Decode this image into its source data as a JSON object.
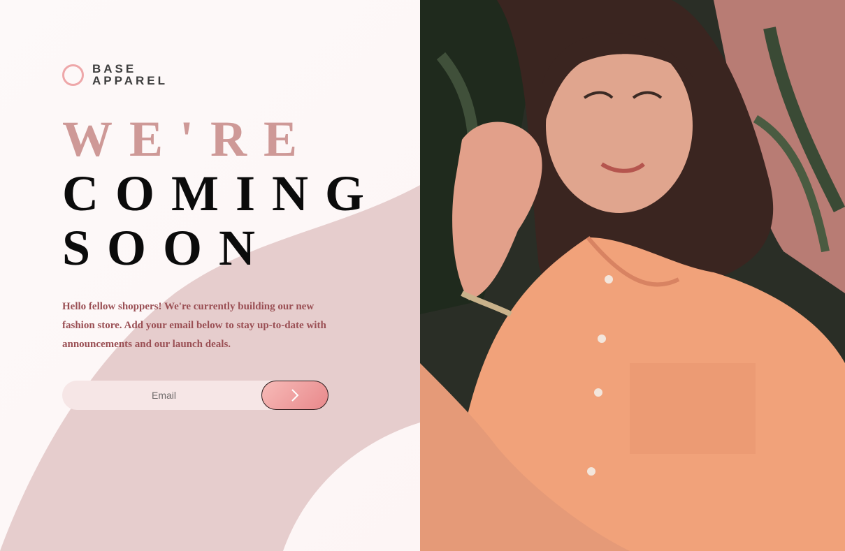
{
  "brand": {
    "line1": "BASE",
    "line2": "APPAREL"
  },
  "headline": {
    "line1": "WE'RE",
    "line2": "COMING",
    "line3": "SOON"
  },
  "intro": "Hello fellow shoppers! We're currently building our new fashion store. Add your email below to stay up-to-date with announcements and our launch deals.",
  "form": {
    "email_placeholder": "Email",
    "submit_icon": "arrow-right-icon"
  },
  "colors": {
    "accent": "#ce9997",
    "text_body": "#9a4f54",
    "button_start": "#f7bbb8",
    "button_end": "#e8888b"
  },
  "hero_image": {
    "icon": "hero-photo-icon"
  }
}
